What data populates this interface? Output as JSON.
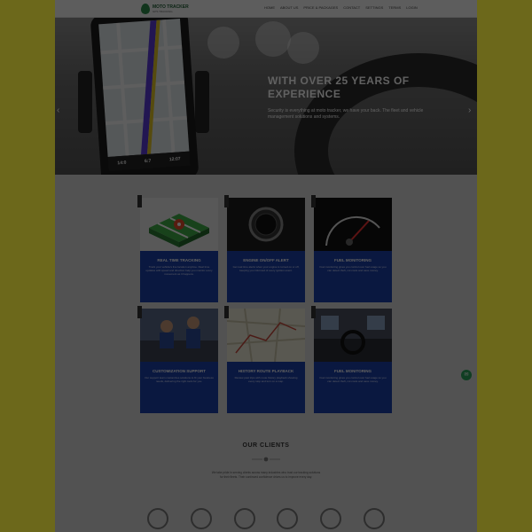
{
  "header": {
    "logo_title": "MOTO TRACKER",
    "logo_subtitle": "GPS TRACKING",
    "nav": [
      "HOME",
      "ABOUT US",
      "PRICE & PACKAGES",
      "CONTACT",
      "SETTINGS",
      "TERMS",
      "LOGIN"
    ]
  },
  "hero": {
    "title": "WITH OVER 25 YEARS OF EXPERIENCE",
    "subtitle": "Security is everything at moto tracker, we have your back. The fleet and vehicle management solutions and systems.",
    "phone_stats": [
      "14:0",
      "6:7",
      "12:07"
    ]
  },
  "features": [
    {
      "title": "REAL TIME TRACKING",
      "text": "Track your vehicle's live location anytime. Real time updates with speed and direction help you monitor every movement as it happens.",
      "icon": "map-pin-icon"
    },
    {
      "title": "ENGINE ON/OFF ALERT",
      "text": "Get real time alerts when your engine is turned on or off, keeping you informed of every ignition event.",
      "icon": "engine-button-icon"
    },
    {
      "title": "FUEL MONITORING",
      "text": "Fuel monitoring gives you control over fuel usage so you can detect theft, cut costs and save money.",
      "icon": "fuel-gauge-icon"
    },
    {
      "title": "CUSTOMIZATION SUPPORT",
      "text": "Our support team customizes solutions to fit your business needs, delivering the right tools for you.",
      "icon": "mechanics-icon"
    },
    {
      "title": "HISTORY ROUTE PLAYBACK",
      "text": "Review past trips with route history playback showing every stop and turn on a map.",
      "icon": "route-map-icon"
    },
    {
      "title": "FUEL MONITORING",
      "text": "Fuel monitoring gives you control over fuel usage so you can detect theft, cut costs and save money.",
      "icon": "dashboard-icon"
    }
  ],
  "clients": {
    "title": "OUR CLIENTS",
    "text": "We take pride in serving clients across many industries who trust our tracking solutions for their fleets. Their continued confidence drives us to improve every day.",
    "logos": [
      "client-logo-1",
      "client-logo-2",
      "client-logo-3",
      "client-logo-4",
      "client-logo-5",
      "client-logo-6"
    ]
  },
  "colors": {
    "accent": "#1c3fa8",
    "brand": "#2e8b4a",
    "outer_bg": "#6e6a1c"
  }
}
